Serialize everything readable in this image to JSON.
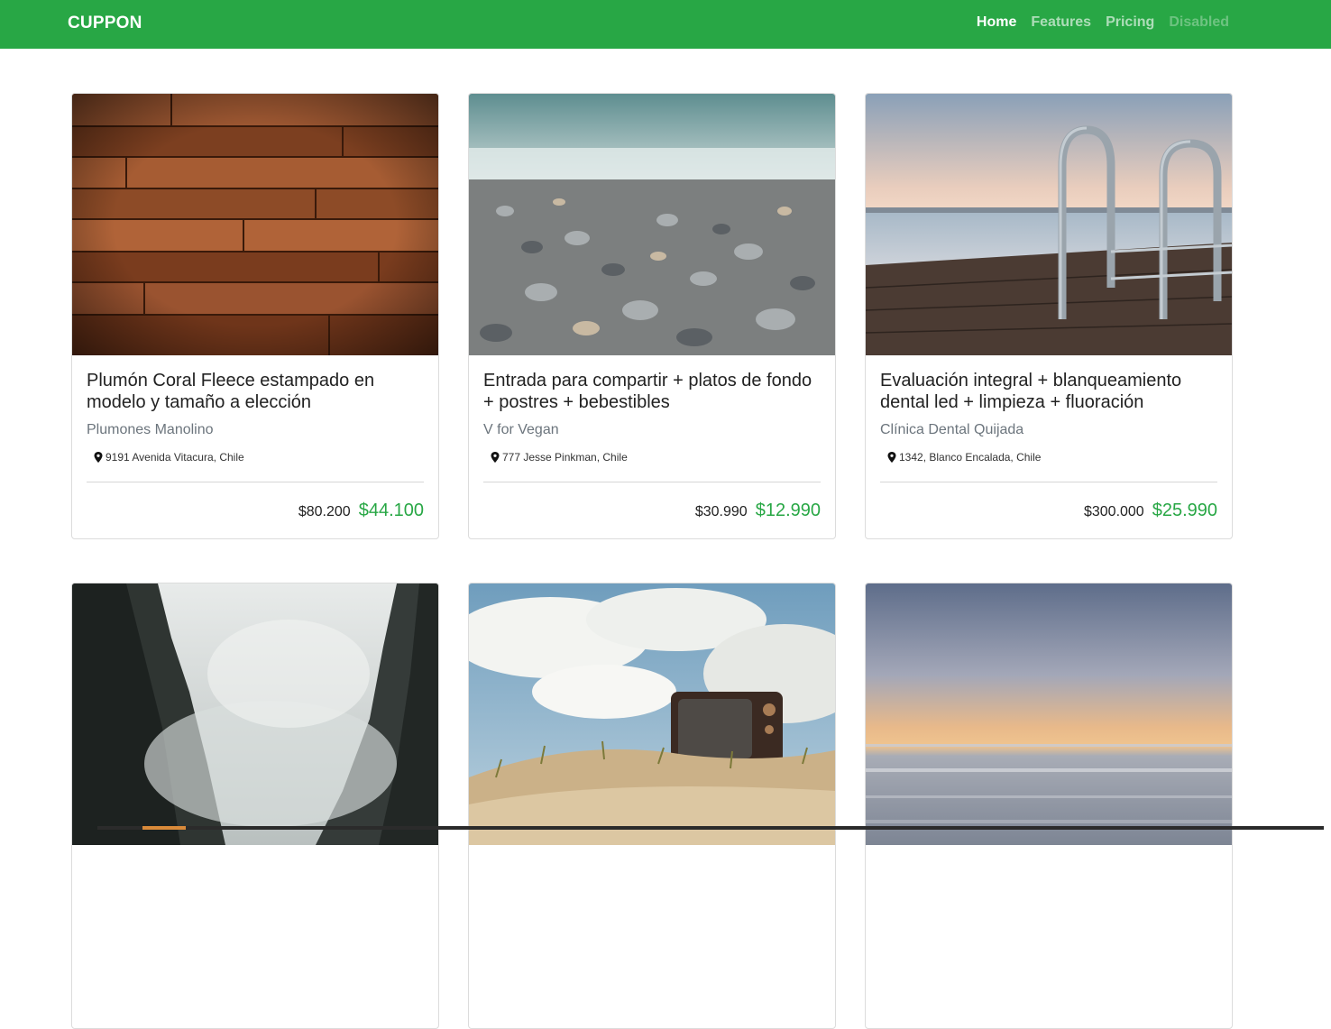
{
  "navbar": {
    "brand": "CUPPON",
    "links": [
      {
        "label": "Home",
        "state": "active"
      },
      {
        "label": "Features",
        "state": "normal"
      },
      {
        "label": "Pricing",
        "state": "normal"
      },
      {
        "label": "Disabled",
        "state": "disabled"
      }
    ],
    "color": "#28a745"
  },
  "cards": [
    {
      "image": "wood-planks-image",
      "title": "Plumón Coral Fleece estampado en modelo y tamaño a elección",
      "merchant": "Plumones Manolino",
      "location": "9191 Avenida Vitacura, Chile",
      "old_price": "$80.200",
      "new_price": "$44.100"
    },
    {
      "image": "pebble-beach-image",
      "title": "Entrada para compartir + platos de fondo + postres + bebestibles",
      "merchant": "V for Vegan",
      "location": "777 Jesse Pinkman, Chile",
      "old_price": "$30.990",
      "new_price": "$12.990"
    },
    {
      "image": "dock-ladder-image",
      "title": "Evaluación integral + blanqueamiento dental led + limpieza + fluoración",
      "merchant": "Clínica Dental Quijada",
      "location": "1342, Blanco Encalada, Chile",
      "old_price": "$300.000",
      "new_price": "$25.990"
    },
    {
      "image": "foggy-cliffs-image"
    },
    {
      "image": "tv-on-beach-image"
    },
    {
      "image": "sunset-sea-image"
    }
  ],
  "colors": {
    "price_new": "#28a745",
    "merchant": "#6c757d"
  }
}
